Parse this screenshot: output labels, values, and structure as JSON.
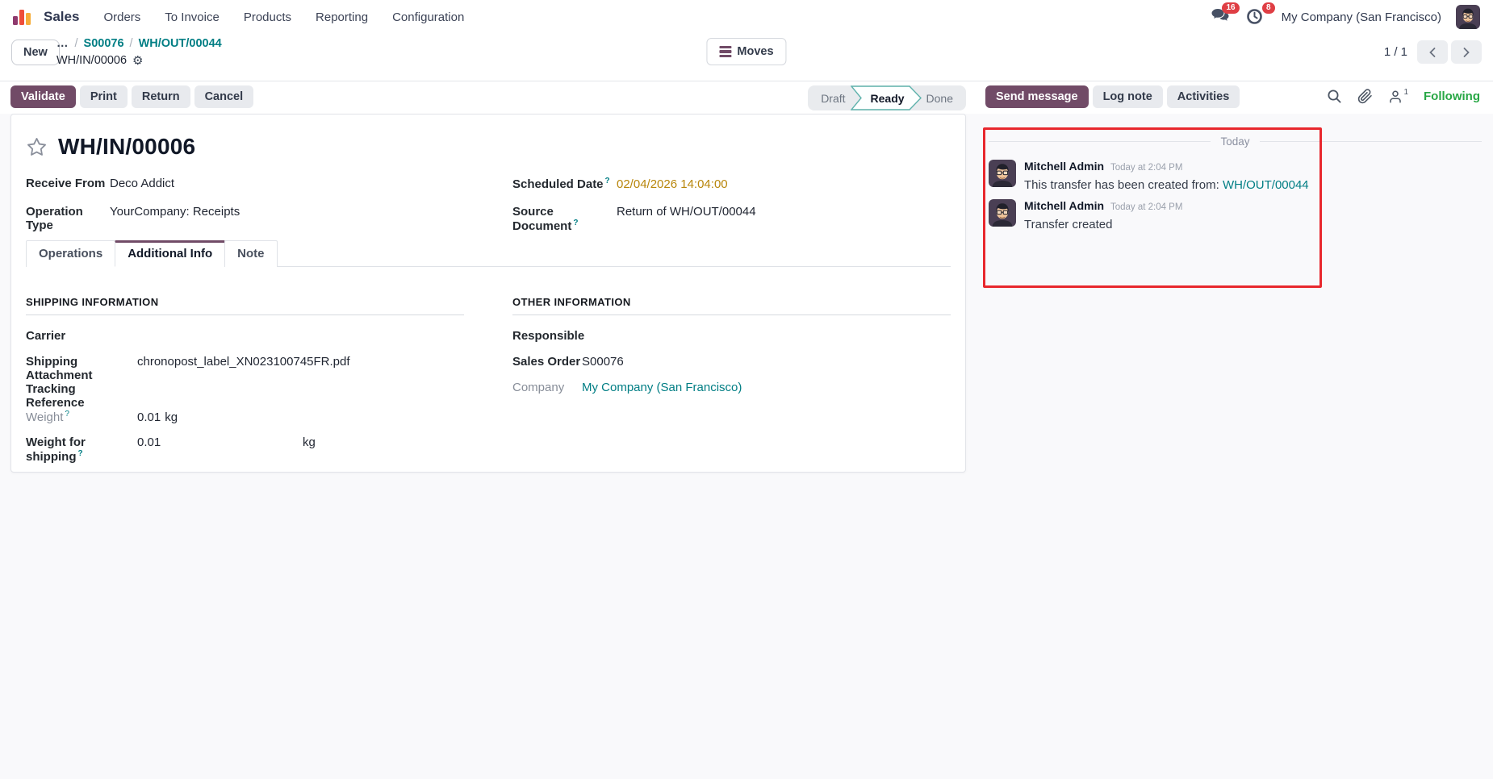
{
  "ui": {
    "help": "?",
    "ellipsis": "…",
    "slash": "/"
  },
  "nav": {
    "app": "Sales",
    "items": [
      "Orders",
      "To Invoice",
      "Products",
      "Reporting",
      "Configuration"
    ],
    "messages_badge": "16",
    "activities_badge": "8",
    "company": "My Company (San Francisco)"
  },
  "breadcrumb": {
    "new_label": "New",
    "link1": "S00076",
    "link2": "WH/OUT/00044",
    "current": "WH/IN/00006"
  },
  "toolbar": {
    "moves_label": "Moves",
    "pager": "1 / 1"
  },
  "actions": {
    "validate": "Validate",
    "print": "Print",
    "return": "Return",
    "cancel": "Cancel"
  },
  "statusbar": {
    "draft": "Draft",
    "ready": "Ready",
    "done": "Done"
  },
  "chatter": {
    "send_message": "Send message",
    "log_note": "Log note",
    "activities": "Activities",
    "followers_count": "1",
    "following": "Following",
    "divider": "Today",
    "messages": [
      {
        "author": "Mitchell Admin",
        "time": "Today at 2:04 PM",
        "text": "This transfer has been created from: ",
        "link": "WH/OUT/00044"
      },
      {
        "author": "Mitchell Admin",
        "time": "Today at 2:04 PM",
        "text": "Transfer created",
        "link": ""
      }
    ]
  },
  "form": {
    "title": "WH/IN/00006",
    "receive_from_label": "Receive From",
    "receive_from": "Deco Addict",
    "operation_type_label": "Operation Type",
    "operation_type": "YourCompany: Receipts",
    "scheduled_date_label": "Scheduled Date",
    "scheduled_date": "02/04/2026 14:04:00",
    "source_document_label": "Source Document",
    "source_document": "Return of WH/OUT/00044",
    "tabs": [
      "Operations",
      "Additional Info",
      "Note"
    ],
    "shipping": {
      "heading": "SHIPPING INFORMATION",
      "carrier_label": "Carrier",
      "attachment_label": "Shipping Attachment",
      "attachment": "chronopost_label_XN023100745FR.pdf",
      "tracking_label": "Tracking Reference",
      "weight_label": "Weight",
      "weight": "0.01",
      "weight_unit": "kg",
      "weight_shipping_label": "Weight for shipping",
      "weight_shipping": "0.01",
      "weight_shipping_unit": "kg"
    },
    "other": {
      "heading": "OTHER INFORMATION",
      "responsible_label": "Responsible",
      "sales_order_label": "Sales Order",
      "sales_order": "S00076",
      "company_label": "Company",
      "company": "My Company (San Francisco)"
    }
  },
  "colors": {
    "brand": "#714B67",
    "link": "#017e84",
    "date_warning": "#b8860b",
    "following_green": "#28a745",
    "annotation_red": "#e8272d",
    "badge_red": "#df3e44"
  }
}
